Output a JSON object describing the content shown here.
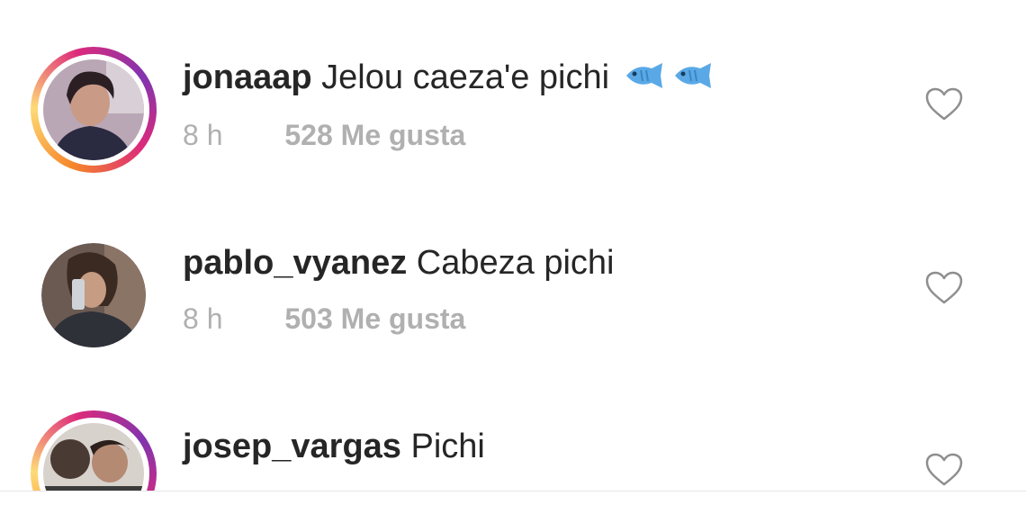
{
  "comments": [
    {
      "username": "jonaaap",
      "text": "Jelou caeza'e pichi",
      "emoji": [
        "fish-emoji",
        "fish-emoji"
      ],
      "time": "8 h",
      "likes": "528 Me gusta",
      "has_story_ring": true
    },
    {
      "username": "pablo_vyanez",
      "text": "Cabeza pichi",
      "time": "8 h",
      "likes": "503 Me gusta",
      "has_story_ring": false
    },
    {
      "username": "josep_vargas",
      "text": "Pichi",
      "has_story_ring": true
    }
  ],
  "icons": {
    "like": "heart-outline-icon",
    "emoji": "fish-emoji"
  },
  "colors": {
    "text": "#262626",
    "meta": "#b0b0b0",
    "icon": "#8e8e8e",
    "story_ring": [
      "#f58529",
      "#dd2a7b",
      "#8134af"
    ],
    "fish": "#5aa9e6"
  }
}
